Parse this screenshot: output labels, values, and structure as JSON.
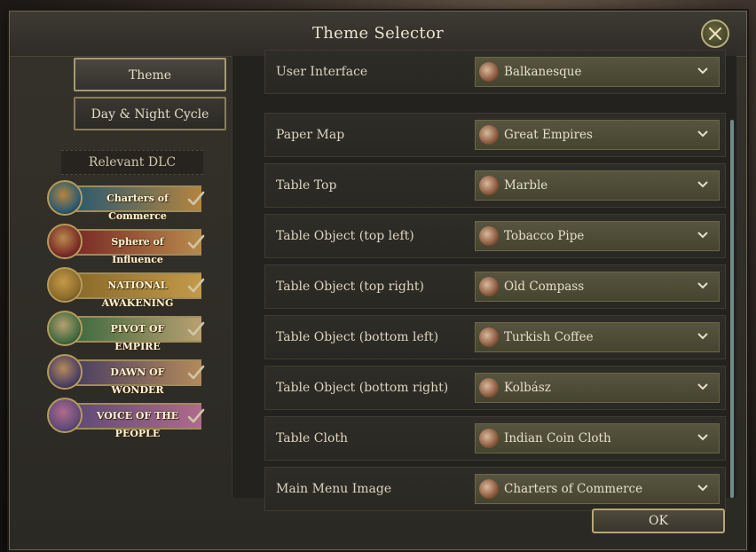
{
  "dialog": {
    "title": "Theme Selector"
  },
  "tabs": [
    {
      "label": "Theme",
      "active": true
    },
    {
      "label": "Day & Night Cycle",
      "active": false
    }
  ],
  "dlc_section": {
    "heading": "Relevant DLC",
    "items": [
      {
        "name": "Charters of Commerce",
        "logo": "Charters of Commerce",
        "owned": true,
        "colors": [
          "#2b5a70",
          "#b5843f"
        ]
      },
      {
        "name": "Sphere of Influence",
        "logo": "Sphere of Influence",
        "owned": true,
        "colors": [
          "#7a2a26",
          "#b88a4c"
        ]
      },
      {
        "name": "National Awakening",
        "logo": "NATIONAL AWAKENING",
        "owned": true,
        "colors": [
          "#8a6a2a",
          "#c49a48"
        ]
      },
      {
        "name": "Pivot of Empire",
        "logo": "PIVOT OF EMPIRE",
        "owned": true,
        "colors": [
          "#3f6a40",
          "#b8a070"
        ]
      },
      {
        "name": "Dawn of Wonder",
        "logo": "DAWN OF WONDER",
        "owned": true,
        "colors": [
          "#4a3f63",
          "#b48a5a"
        ]
      },
      {
        "name": "Voice of the People",
        "logo": "VOICE OF THE PEOPLE",
        "owned": true,
        "colors": [
          "#5f4a78",
          "#b06a8c"
        ]
      }
    ]
  },
  "settings": [
    {
      "label": "User Interface",
      "value": "Balkanesque"
    },
    {
      "label": "Paper Map",
      "value": "Great Empires"
    },
    {
      "label": "Table Top",
      "value": "Marble"
    },
    {
      "label": "Table Object (top left)",
      "value": "Tobacco Pipe"
    },
    {
      "label": "Table Object (top right)",
      "value": "Old Compass"
    },
    {
      "label": "Table Object (bottom left)",
      "value": "Turkish Coffee"
    },
    {
      "label": "Table Object (bottom right)",
      "value": "Kolbász"
    },
    {
      "label": "Table Cloth",
      "value": "Indian Coin Cloth"
    },
    {
      "label": "Main Menu Image",
      "value": "Charters of Commerce"
    }
  ],
  "footer": {
    "ok_label": "OK"
  },
  "icons": {
    "close": "close-icon",
    "dropdown": "chevron-down-icon",
    "owned": "checkmark-icon"
  }
}
